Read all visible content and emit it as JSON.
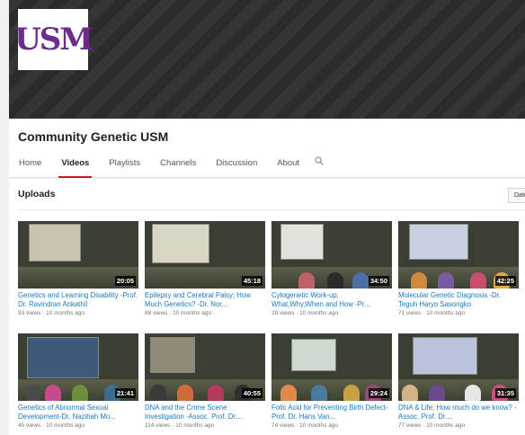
{
  "banner": {
    "logo_text": "USM"
  },
  "channel": {
    "title": "Community Genetic USM"
  },
  "tabs": [
    {
      "label": "Home",
      "active": false
    },
    {
      "label": "Videos",
      "active": true
    },
    {
      "label": "Playlists",
      "active": false
    },
    {
      "label": "Channels",
      "active": false
    },
    {
      "label": "Discussion",
      "active": false
    },
    {
      "label": "About",
      "active": false
    }
  ],
  "uploads": {
    "title": "Uploads",
    "sort_label": "Date"
  },
  "videos": [
    {
      "title": "Genetics and Learning Disability -Prof. Dr. Ravindran Ankathil",
      "duration": "20:05",
      "views": "93 views",
      "age": "10 months ago"
    },
    {
      "title": "Epilepsy and Cerebral Palsy; How Much Genetics? -Dr. Nor...",
      "duration": "45:18",
      "views": "88 views",
      "age": "10 months ago"
    },
    {
      "title": "Cytogenetic Work-up; What,Why,When and How -Pr...",
      "duration": "34:50",
      "views": "29 views",
      "age": "10 months ago"
    },
    {
      "title": "Molecular Genetic Diagnosis -Dr. Teguh Haryo Sasongko",
      "duration": "42:25",
      "views": "71 views",
      "age": "10 months ago"
    },
    {
      "title": "Genetics of Abnormal Sexual Development-Dr. Nazihah Mo...",
      "duration": "21:41",
      "views": "45 views",
      "age": "10 months ago"
    },
    {
      "title": "DNA and the Crime Scene Investigation -Assoc. Prof. Dr....",
      "duration": "40:55",
      "views": "114 views",
      "age": "10 months ago"
    },
    {
      "title": "Folic Acid for Preventing Birth Defect-Prof. Dr. Hans Van...",
      "duration": "29:24",
      "views": "74 views",
      "age": "10 months ago"
    },
    {
      "title": "DNA & Life; How much do we know? -Assoc. Prof. Dr....",
      "duration": "31:35",
      "views": "77 views",
      "age": "10 months ago"
    }
  ],
  "meta_separator": "·",
  "colors": {
    "accent": "#cc181e",
    "link": "#167ac6",
    "banner": "#2d2d2d",
    "logo_purple": "#6b2c8a",
    "logo_gold": "#d6a21b"
  },
  "icons": {
    "search_tab": "search-icon"
  }
}
